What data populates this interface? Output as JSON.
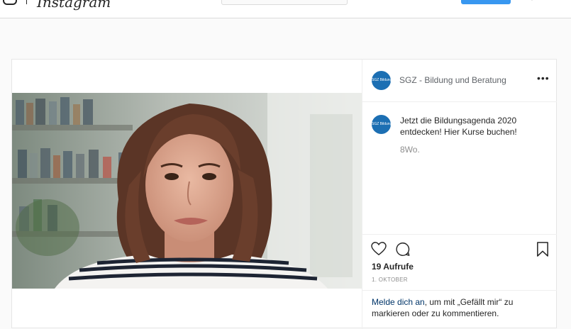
{
  "topbar": {
    "logo_text": "Instagram"
  },
  "post": {
    "account": {
      "name": "SGZ - Bildung und Beratung",
      "avatar_text": "SGZ Bildung"
    },
    "caption": {
      "text": "Jetzt die Bildungsagenda 2020 entdecken! Hier Kurse buchen!",
      "time_ago": "8Wo."
    },
    "more_label": "•••",
    "stats": {
      "views": "19 Aufrufe",
      "date": "1. OKTOBER"
    },
    "login_prompt": {
      "link": "Melde dich an",
      "rest": ", um mit „Gefällt mir“ zu markieren oder zu kommentieren."
    }
  },
  "icons": {
    "camera": "camera-icon",
    "like": "heart-icon",
    "comment": "comment-icon",
    "save": "bookmark-icon",
    "more": "more-icon"
  },
  "colors": {
    "brand_button": "#3897f0",
    "avatar_bg": "#1c6fb3",
    "link": "#003569",
    "muted": "#8e8e8e"
  }
}
